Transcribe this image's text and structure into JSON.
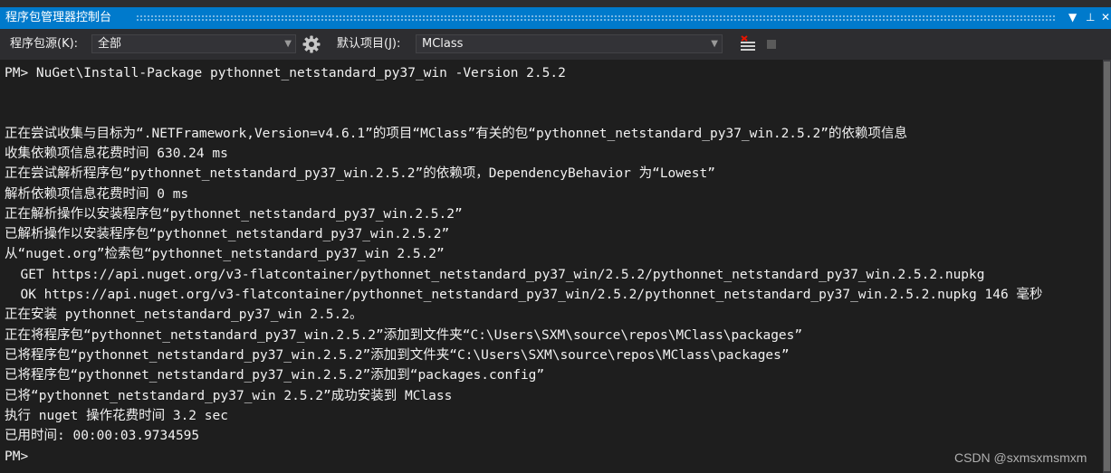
{
  "window": {
    "title": "程序包管理器控制台",
    "controls": {
      "dropdown": "▼",
      "pin": "⊥",
      "close": "✕"
    }
  },
  "toolbar": {
    "source_label": "程序包源(K):",
    "source_value": "全部",
    "settings_icon": "gear-icon",
    "project_label": "默认项目(J):",
    "project_value": "MClass",
    "clear_icon": "clear-console-icon",
    "stop_icon": "stop-icon"
  },
  "console": {
    "lines": [
      "PM> NuGet\\Install-Package pythonnet_netstandard_py37_win -Version 2.5.2",
      "",
      "",
      "正在尝试收集与目标为“.NETFramework,Version=v4.6.1”的项目“MClass”有关的包“pythonnet_netstandard_py37_win.2.5.2”的依赖项信息",
      "收集依赖项信息花费时间 630.24 ms",
      "正在尝试解析程序包“pythonnet_netstandard_py37_win.2.5.2”的依赖项，DependencyBehavior 为“Lowest”",
      "解析依赖项信息花费时间 0 ms",
      "正在解析操作以安装程序包“pythonnet_netstandard_py37_win.2.5.2”",
      "已解析操作以安装程序包“pythonnet_netstandard_py37_win.2.5.2”",
      "从“nuget.org”检索包“pythonnet_netstandard_py37_win 2.5.2”",
      "  GET https://api.nuget.org/v3-flatcontainer/pythonnet_netstandard_py37_win/2.5.2/pythonnet_netstandard_py37_win.2.5.2.nupkg",
      "  OK https://api.nuget.org/v3-flatcontainer/pythonnet_netstandard_py37_win/2.5.2/pythonnet_netstandard_py37_win.2.5.2.nupkg 146 毫秒",
      "正在安装 pythonnet_netstandard_py37_win 2.5.2。",
      "正在将程序包“pythonnet_netstandard_py37_win.2.5.2”添加到文件夹“C:\\Users\\SXM\\source\\repos\\MClass\\packages”",
      "已将程序包“pythonnet_netstandard_py37_win.2.5.2”添加到文件夹“C:\\Users\\SXM\\source\\repos\\MClass\\packages”",
      "已将程序包“pythonnet_netstandard_py37_win.2.5.2”添加到“packages.config”",
      "已将“pythonnet_netstandard_py37_win 2.5.2”成功安装到 MClass",
      "执行 nuget 操作花费时间 3.2 sec",
      "已用时间: 00:00:03.9734595",
      "PM>"
    ]
  },
  "watermark": "CSDN @sxmsxmsmxm",
  "colors": {
    "accent": "#007acc",
    "background": "#1e1e1e",
    "toolbar": "#2d2d30",
    "text": "#f1f1f1"
  }
}
